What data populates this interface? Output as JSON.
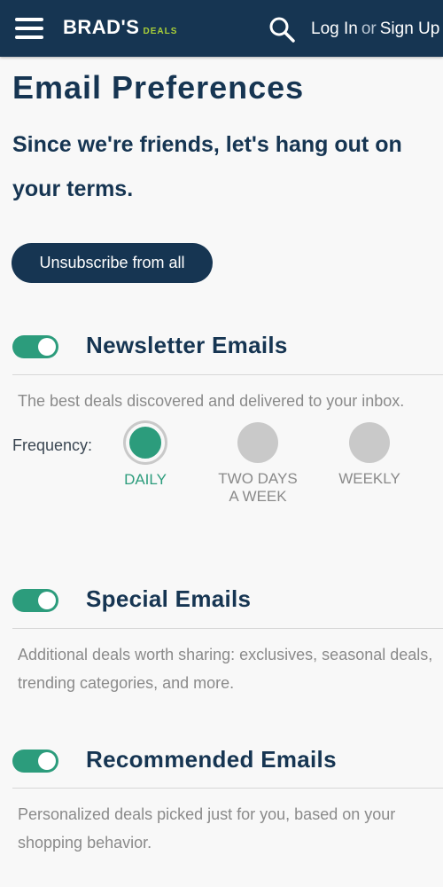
{
  "header": {
    "logo_main": "BRAD'S",
    "logo_sub": "DEALS",
    "login_label": "Log In",
    "or_label": "or",
    "signup_label": "Sign Up"
  },
  "page": {
    "title": "Email Preferences",
    "subtitle": "Since we're friends, let's hang out on your terms.",
    "unsubscribe_label": "Unsubscribe from all"
  },
  "sections": [
    {
      "title": "Newsletter Emails",
      "enabled": true,
      "description": "The best deals discovered and delivered to your inbox."
    },
    {
      "title": "Special Emails",
      "enabled": true,
      "description": "Additional deals worth sharing: exclusives, seasonal deals, trending categories, and more."
    },
    {
      "title": "Recommended Emails",
      "enabled": true,
      "description": "Personalized deals picked just for you, based on your shopping behavior."
    }
  ],
  "frequency": {
    "label": "Frequency:",
    "options": [
      {
        "line1": "DAILY",
        "line2": "",
        "selected": true
      },
      {
        "line1": "TWO DAYS",
        "line2": "A WEEK",
        "selected": false
      },
      {
        "line1": "WEEKLY",
        "line2": "",
        "selected": false
      }
    ]
  },
  "colors": {
    "navy": "#163552",
    "accent_green": "#2c9c7c",
    "logo_green": "#a9cf38",
    "muted_text": "#8a8a8a",
    "inactive_circle": "#c9c9c9"
  },
  "icons": {
    "menu": "hamburger-menu-icon",
    "search": "search-icon"
  }
}
